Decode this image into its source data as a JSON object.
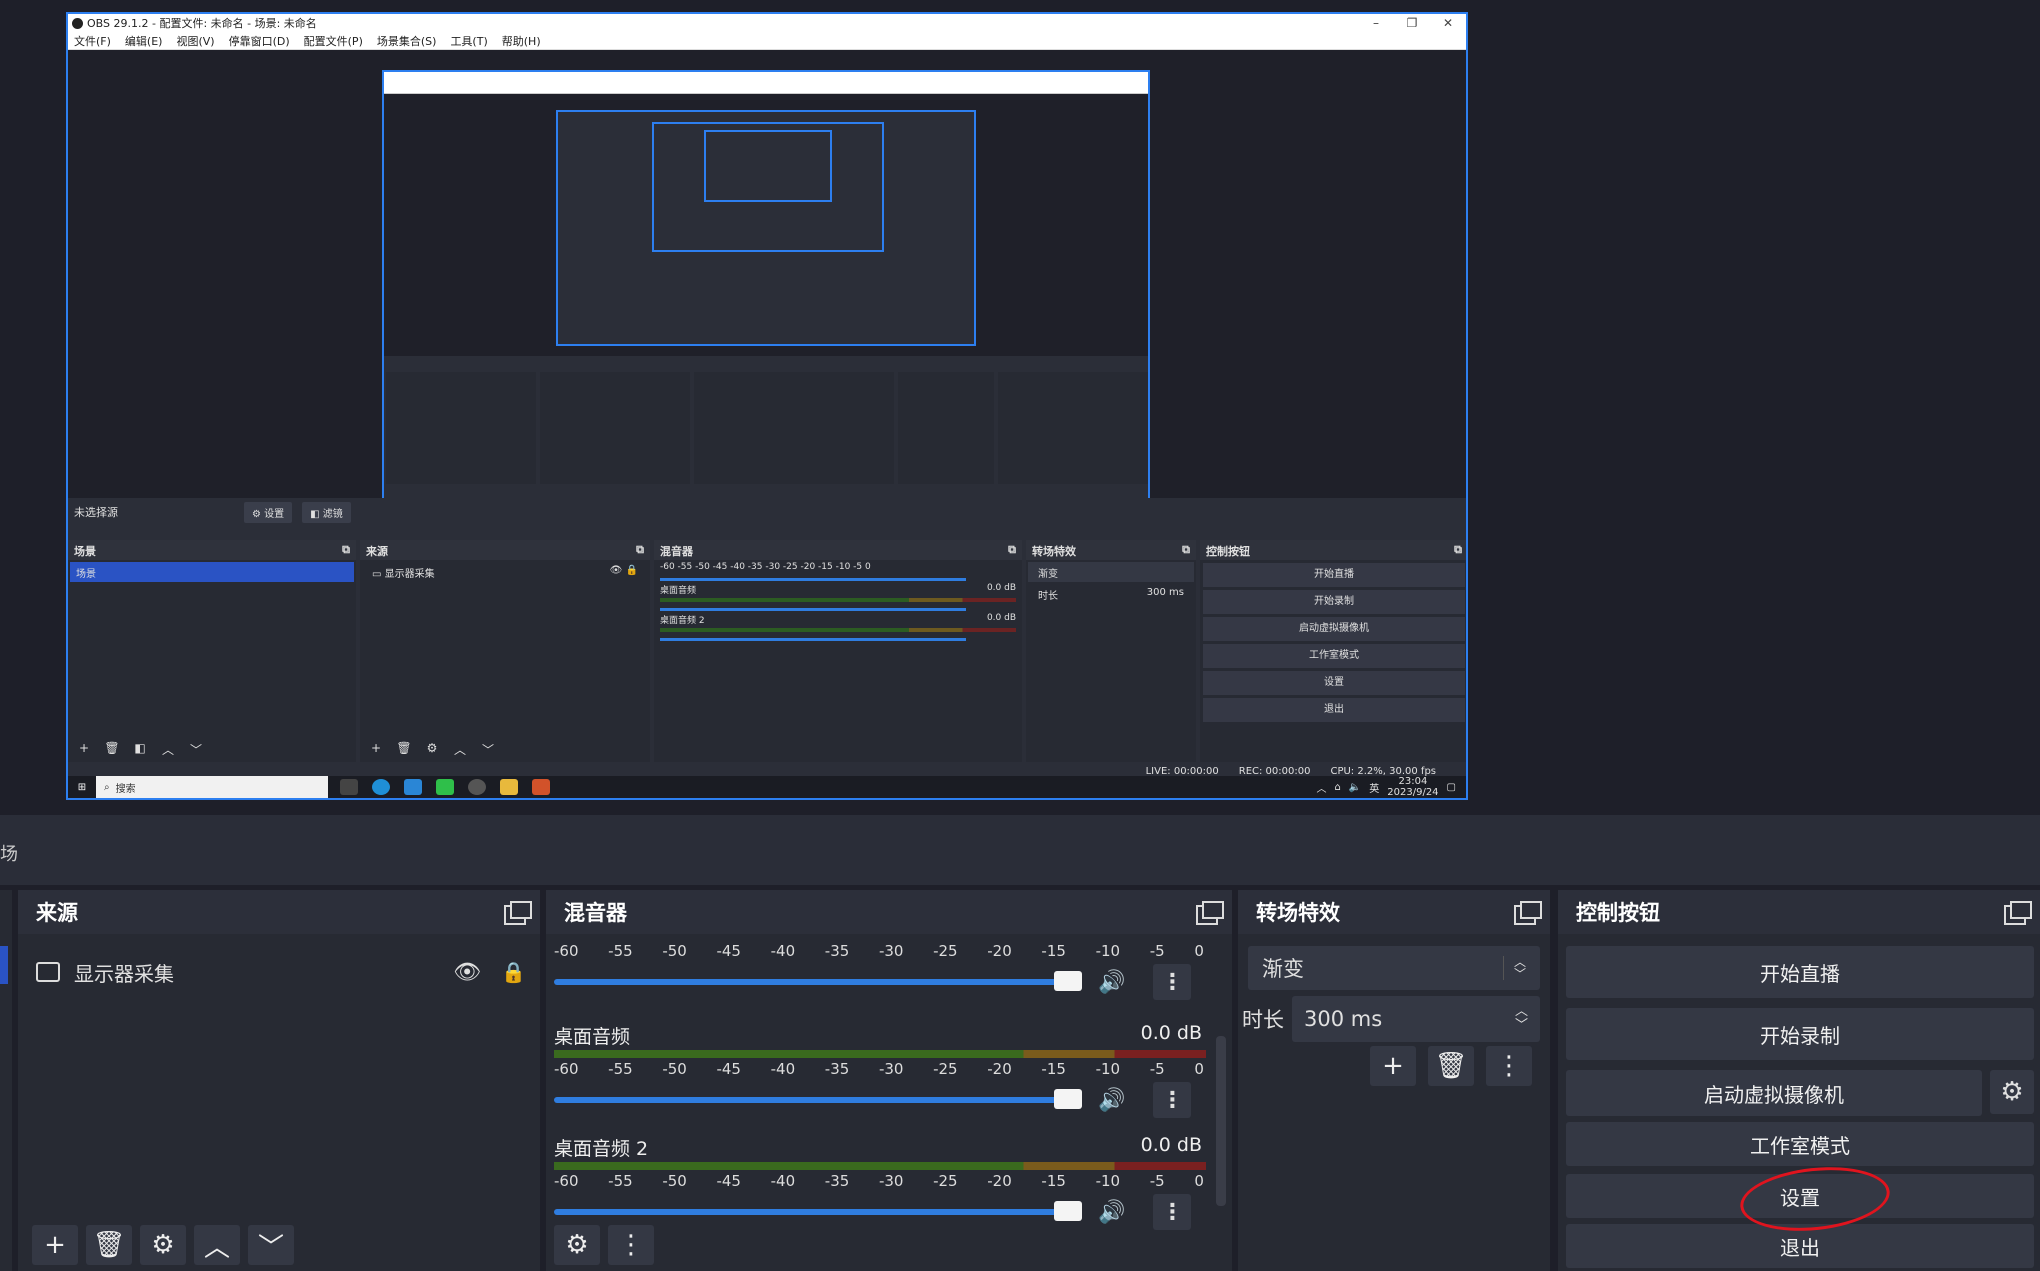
{
  "inner_window": {
    "title": "OBS 29.1.2 - 配置文件: 未命名 - 场景: 未命名",
    "menu": [
      "文件(F)",
      "编辑(E)",
      "视图(V)",
      "停靠窗口(D)",
      "配置文件(P)",
      "场景集合(S)",
      "工具(T)",
      "帮助(H)"
    ],
    "no_source": "未选择源",
    "settings_btn": "设置",
    "filters_btn": "滤镜",
    "scenes": {
      "title": "场景",
      "item": "场景"
    },
    "sources": {
      "title": "来源",
      "item": "显示器采集"
    },
    "mixer": {
      "title": "混音器",
      "ticks": "-60  -55  -50  -45  -40  -35  -30  -25  -20  -15  -10  -5  0",
      "tracks": [
        {
          "name": "桌面音频",
          "level": "0.0 dB"
        },
        {
          "name": "桌面音频 2",
          "level": "0.0 dB"
        }
      ]
    },
    "transitions": {
      "title": "转场特效",
      "type": "渐变",
      "duration_label": "时长",
      "duration": "300 ms"
    },
    "controls": {
      "title": "控制按钮",
      "buttons": [
        "开始直播",
        "开始录制",
        "启动虚拟摄像机",
        "工作室模式",
        "设置",
        "退出"
      ]
    },
    "status": {
      "live": "LIVE: 00:00:00",
      "rec": "REC: 00:00:00",
      "cpu": "CPU: 2.2%, 30.00 fps"
    },
    "taskbar": {
      "search_placeholder": "搜索",
      "ime": "英",
      "time": "23:04",
      "date": "2023/9/24"
    }
  },
  "main": {
    "scene_fragment": "场",
    "sources": {
      "title": "来源",
      "item": "显示器采集"
    },
    "mixer": {
      "title": "混音器",
      "ticks": [
        "-60",
        "-55",
        "-50",
        "-45",
        "-40",
        "-35",
        "-30",
        "-25",
        "-20",
        "-15",
        "-10",
        "-5",
        "0"
      ],
      "tracks": [
        {
          "name": "",
          "level": ""
        },
        {
          "name": "桌面音频",
          "level": "0.0 dB"
        },
        {
          "name": "桌面音频 2",
          "level": "0.0 dB"
        }
      ]
    },
    "transitions": {
      "title": "转场特效",
      "type": "渐变",
      "duration_label": "时长",
      "duration": "300 ms"
    },
    "controls": {
      "title": "控制按钮",
      "start_stream": "开始直播",
      "start_record": "开始录制",
      "virtual_cam": "启动虚拟摄像机",
      "studio_mode": "工作室模式",
      "settings": "设置",
      "exit": "退出"
    }
  },
  "colors": {
    "accent_blue": "#2d7ff0",
    "selection": "#2a53c4",
    "annotation_red": "#e0141e",
    "panel_bg": "#272a33"
  }
}
